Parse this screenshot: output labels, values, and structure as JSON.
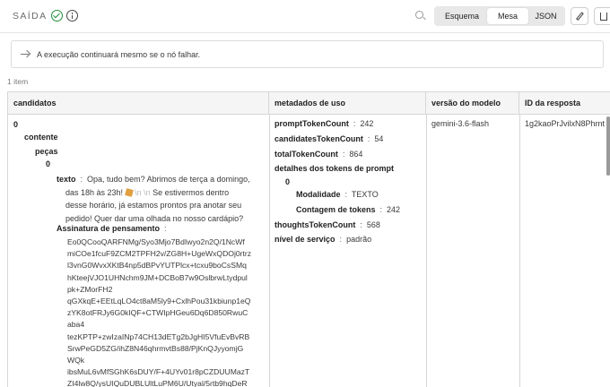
{
  "header": {
    "title": "SAÍDA",
    "status_icon": "check-circle-icon",
    "info_icon": "info-icon",
    "view_tabs": [
      "Esquema",
      "Mesa",
      "JSON"
    ],
    "active_view": "Mesa"
  },
  "notice": {
    "text": "A execução continuará mesmo se o nó falhar."
  },
  "count": "1 item",
  "table": {
    "headers": [
      "candidatos",
      "metadados de uso",
      "versão do modelo",
      "ID da resposta"
    ],
    "candidatos": {
      "index": "0",
      "content_key": "contente",
      "parts_key": "peças",
      "part_index": "0",
      "text_key": "texto",
      "text_line1": "Opa, tudo bem? Abrimos de terça a domingo,",
      "text_line2_a": "das 18h às 23h!",
      "text_line2_esc": "\\n  \\n",
      "text_line2_b": "Se estivermos dentro",
      "text_line3": "desse horário, já estamos prontos pra anotar seu",
      "text_line4": "pedido! Quer dar uma olhada no nosso cardápio?",
      "signature_key": "Assinatura de pensamento",
      "signature_lines": [
        "Eo0QCooQARFNMg/Syo3Mjo7BdIwyo2n2Q/1NcWf",
        "miCOe1fcuF9ZCM2TPFH2v/ZG8H+UgeWxQDOj0rtrz",
        "l3vnG0WvxXKtB4np5dBPvYUTPlcx+tcxu9boCsSMq",
        "hKteejVJO1UHNchm9JM+DCBoB7w9OslbrwLtydpul",
        "pk+ZMorFH2",
        "qGXkqE+EEtLqLO4ct8aM5ly9+CxlhPou31kbiunp1eQ",
        "zYK8otFRJy6G0kIQF+CTWIpHGeu6Dq6D850RwuC",
        "aba4",
        "tezKPTP+zwIzaINp74CH13dETg2bJgHI5VfuEvBvRB",
        "SrwPeGD5ZG/ihZ8N46qhrmvtBs88/PjKnQJyyomjG",
        "WQk",
        "ibsMuL6vMfSGhK6sDUY/F+4UYv01r8pCZDUUMazT",
        "ZI4lw8Q/ysUIQuDUBLUltLuPM6U/Utyal/5rtb9hqDeR"
      ]
    },
    "metadados": {
      "prompt_key": "promptTokenCount",
      "prompt_val": "242",
      "cand_key": "candidatesTokenCount",
      "cand_val": "54",
      "total_key": "totalTokenCount",
      "total_val": "864",
      "details_key": "detalhes dos tokens de prompt",
      "details_index": "0",
      "modality_key": "Modalidade",
      "modality_val": "TEXTO",
      "count_key": "Contagem de tokens",
      "count_val": "242",
      "thoughts_key": "thoughtsTokenCount",
      "thoughts_val": "568",
      "tier_key": "nível de serviço",
      "tier_val": "padrão"
    },
    "model_version": "gemini-3.6-flash",
    "response_id": "1g2kaoPrJvilxN8Phrnt"
  }
}
